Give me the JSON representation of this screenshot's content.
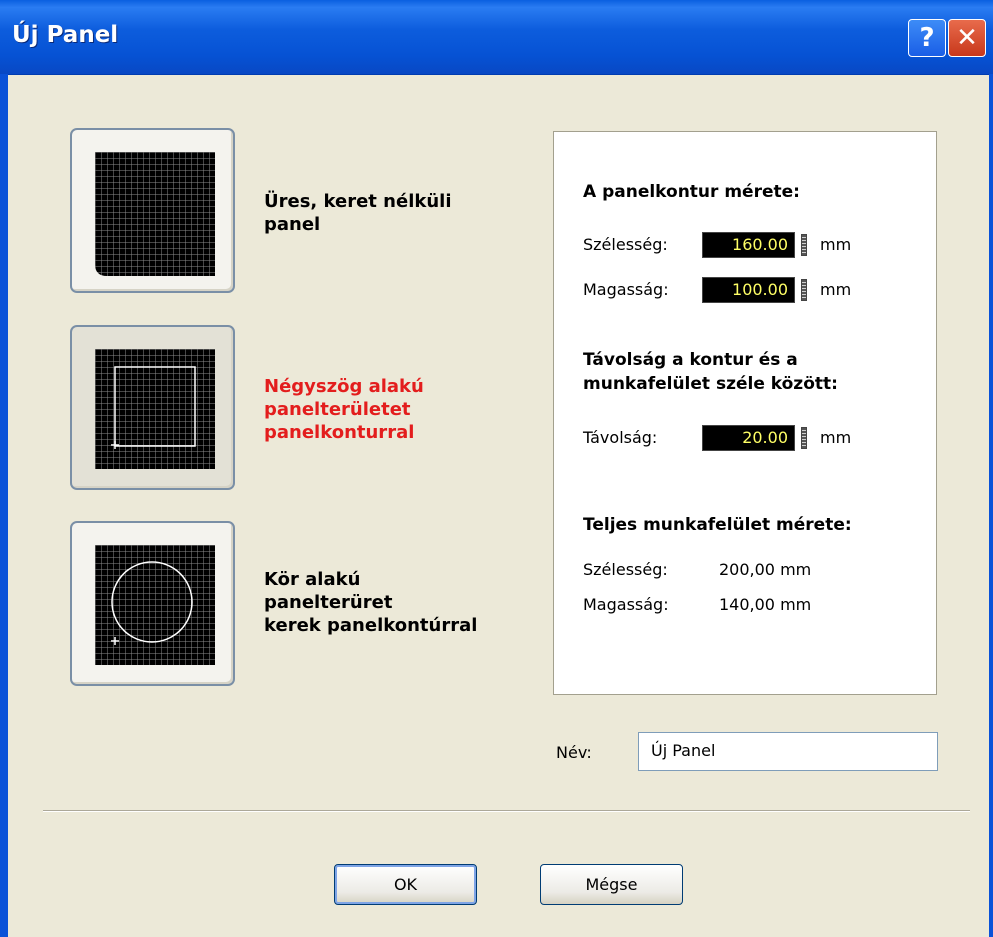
{
  "window": {
    "title": "Új Panel",
    "help_label": "?",
    "close_label": "✕"
  },
  "options": [
    {
      "label": "Üres, keret nélküli\npanel",
      "selected": false
    },
    {
      "label": "Négyszög alakú\npanelterületet\npanelkonturral",
      "selected": true
    },
    {
      "label": "Kör alakú\npanelterüret\nkerek panelkontúrral",
      "selected": false
    }
  ],
  "panel_size": {
    "title": "A panelkontur mérete:",
    "width_label": "Szélesség:",
    "width_value": "160.00",
    "height_label": "Magasság:",
    "height_value": "100.00",
    "unit": "mm"
  },
  "distance": {
    "title": "Távolság a kontur és a\nmunkafelület széle között:",
    "label": "Távolság:",
    "value": "20.00",
    "unit": "mm"
  },
  "workspace": {
    "title": "Teljes munkafelület mérete:",
    "width_label": "Szélesség:",
    "width_value": "200,00 mm",
    "height_label": "Magasság:",
    "height_value": "140,00 mm"
  },
  "name": {
    "label": "Név:",
    "value": "Új Panel"
  },
  "buttons": {
    "ok": "OK",
    "cancel": "Mégse"
  },
  "colors": {
    "accent_red": "#e31d1d",
    "field_bg": "#000000",
    "field_text": "#ffff66",
    "title_bar": "#0a5fe0"
  }
}
